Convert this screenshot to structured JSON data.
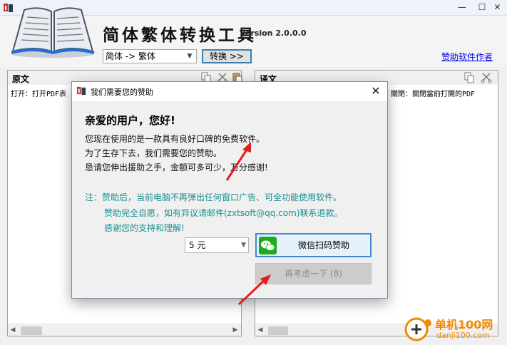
{
  "window": {
    "minimize": "—",
    "maximize": "☐",
    "close": "✕"
  },
  "header": {
    "title": "简体繁体转换工具",
    "version": "Version 2.0.0.0",
    "direction_value": "简体 -> 繁体",
    "convert_label": "转换 >>",
    "sponsor_link": "赞助软件作者"
  },
  "left_panel": {
    "title": "原文",
    "text": "打开：打开PDF表"
  },
  "right_panel": {
    "title": "译文",
    "text": "關閉：關閉當前打開的PDF"
  },
  "dialog": {
    "title": "我们需要您的赞助",
    "close": "✕",
    "greeting": "亲爱的用户，您好!",
    "lines": [
      "您现在使用的是一款具有良好口碑的免费软件。",
      "为了生存下去，我们需要您的赞助。",
      "恳请您伸出援助之手，金额可多可少，万分感谢!"
    ],
    "notes": [
      "注：赞助后，当前电脑不再弹出任何窗口广告、可全功能使用软件。",
      "赞助完全自愿，如有异议请邮件(zxtsoft@qq.com)联系退款。",
      "感谢您的支持和理解!"
    ],
    "amount_value": "5 元",
    "wechat_label": "微信扫码赞助",
    "later_label": "再考虑一下 (8)"
  },
  "watermark": {
    "cn": "单机100网",
    "url": "danji100.com"
  },
  "colors": {
    "accent": "#3f8ad7",
    "note": "#1d8e8e",
    "wechat": "#1aad19",
    "link": "#0000ee",
    "annotation": "#e02020"
  }
}
